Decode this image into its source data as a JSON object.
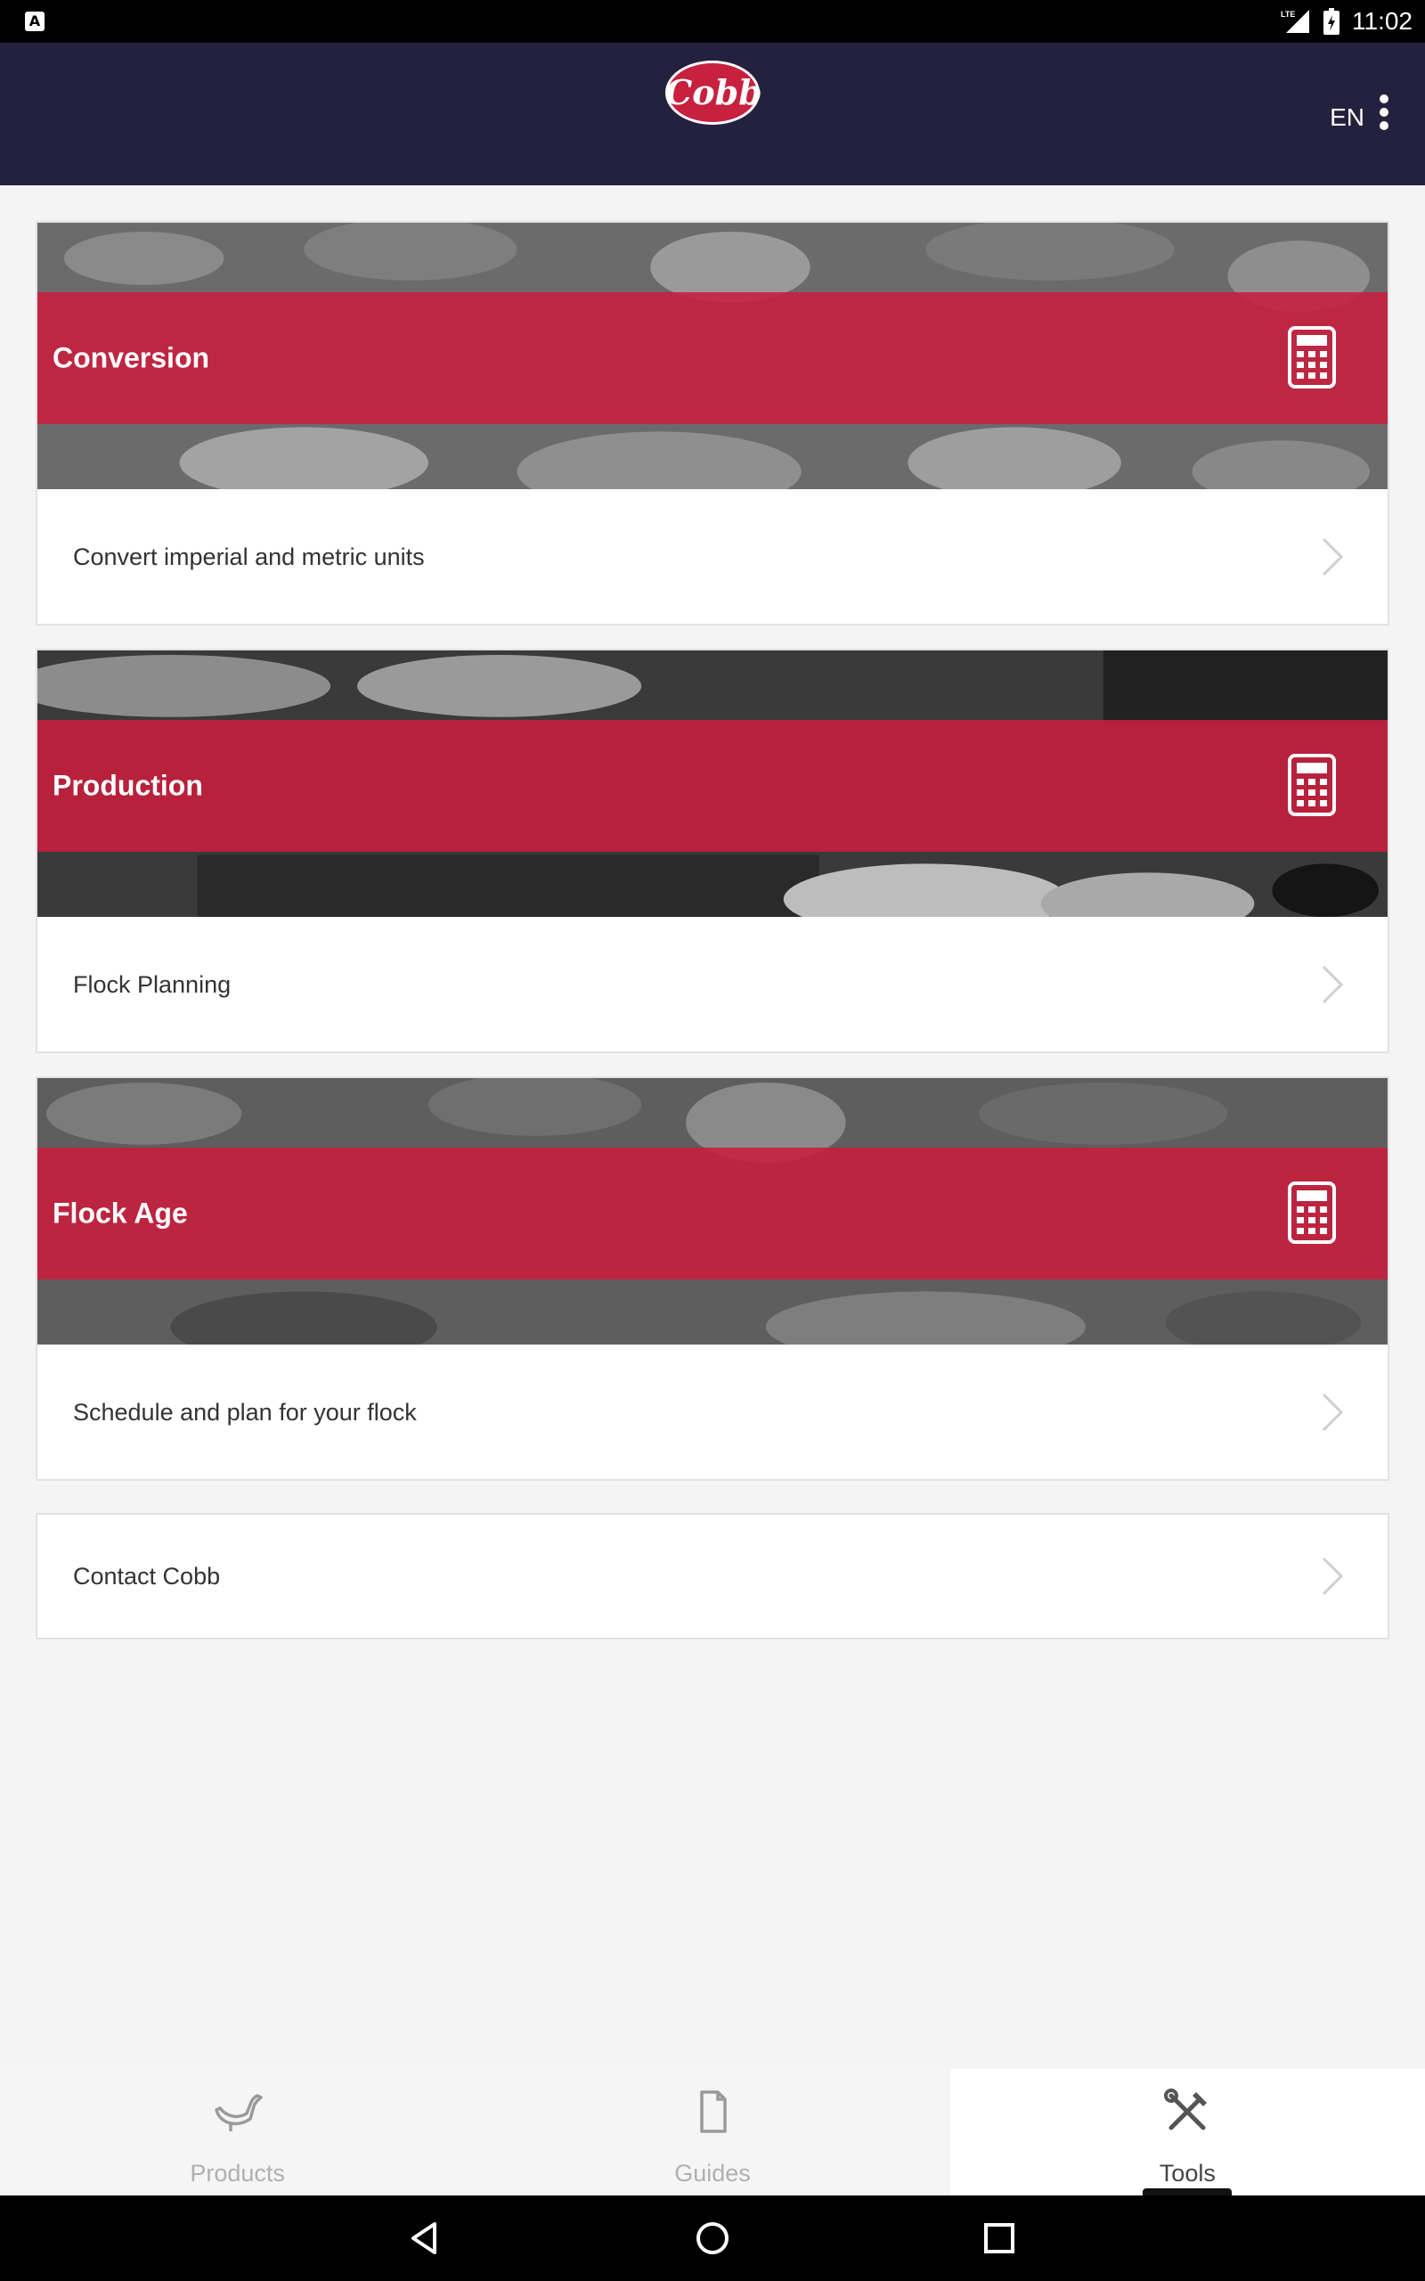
{
  "status_bar": {
    "left_icon": "A",
    "network": "LTE",
    "time": "11:02"
  },
  "app_bar": {
    "logo_text": "Cobb",
    "language": "EN",
    "menu_icon": "more-vert-icon"
  },
  "cards": [
    {
      "title": "Conversion",
      "subtitle": "Convert imperial and metric units",
      "icon": "calculator-icon"
    },
    {
      "title": "Production",
      "subtitle": "Flock Planning",
      "icon": "calculator-icon"
    },
    {
      "title": "Flock Age",
      "subtitle": "Schedule and plan for your flock",
      "icon": "calculator-icon"
    }
  ],
  "contact": {
    "label": "Contact Cobb"
  },
  "bottom_nav": {
    "items": [
      {
        "label": "Products",
        "icon": "chicken-icon",
        "active": false
      },
      {
        "label": "Guides",
        "icon": "document-icon",
        "active": false
      },
      {
        "label": "Tools",
        "icon": "tools-icon",
        "active": true
      }
    ]
  },
  "colors": {
    "app_bar": "#24213f",
    "brand_red": "#c8203f",
    "band_red": "#c81e3c",
    "background": "#f4f4f4"
  }
}
